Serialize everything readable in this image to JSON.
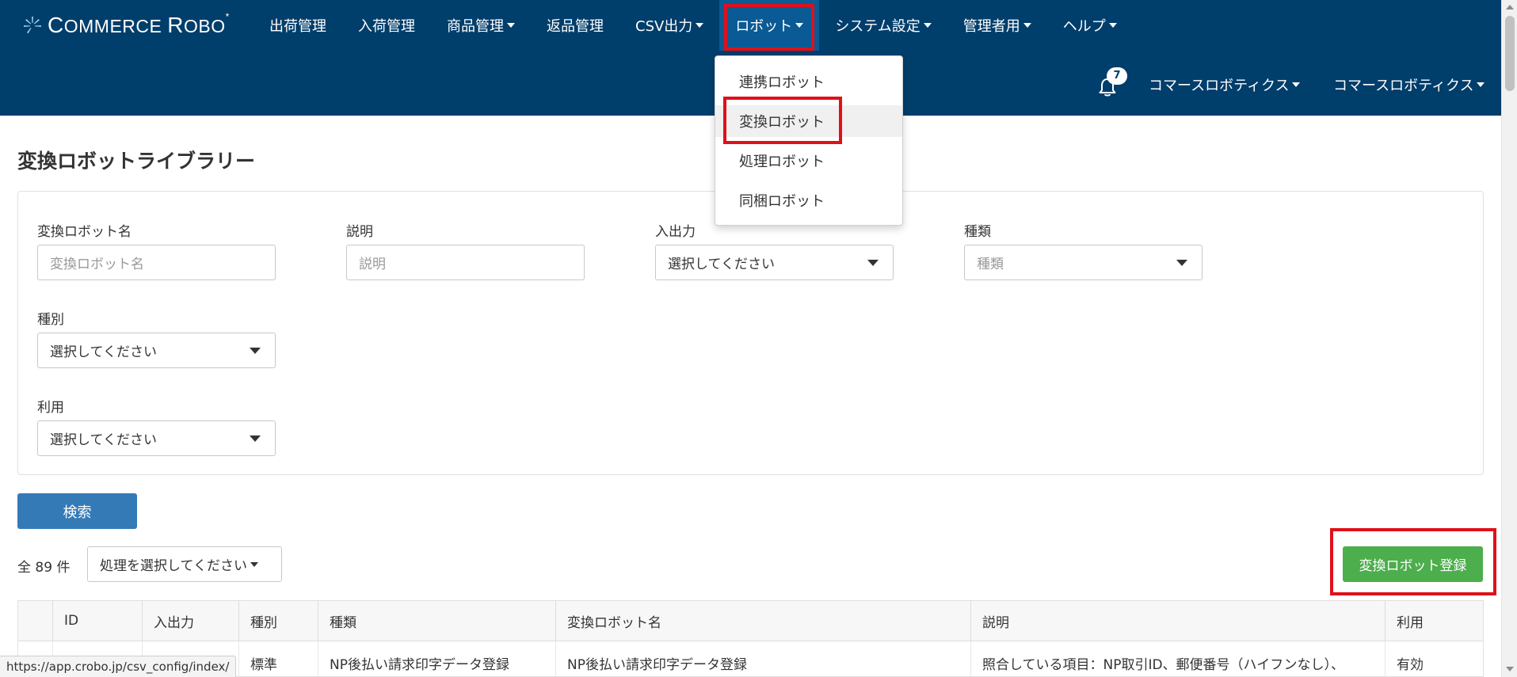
{
  "app": {
    "logo_text_c": "C",
    "logo_text_1": "OMMERCE ",
    "logo_text_r": "R",
    "logo_text_2": "OBO",
    "logo_mark": "*"
  },
  "nav": {
    "items": [
      {
        "label": "出荷管理"
      },
      {
        "label": "入荷管理"
      },
      {
        "label": "商品管理"
      },
      {
        "label": "返品管理"
      },
      {
        "label": "CSV出力"
      },
      {
        "label": "ロボット"
      },
      {
        "label": "システム設定"
      },
      {
        "label": "管理者用"
      },
      {
        "label": "ヘルプ"
      }
    ],
    "notification_count": "7",
    "user_company": "コマースロボティクス",
    "user_name": "コマースロボティクス"
  },
  "robot_menu": {
    "items": [
      {
        "label": "連携ロボット"
      },
      {
        "label": "変換ロボット"
      },
      {
        "label": "処理ロボット"
      },
      {
        "label": "同梱ロボット"
      }
    ]
  },
  "page": {
    "title": "変換ロボットライブラリー"
  },
  "filters": {
    "name_label": "変換ロボット名",
    "name_placeholder": "変換ロボット名",
    "desc_label": "説明",
    "desc_placeholder": "説明",
    "io_label": "入出力",
    "io_value": "選択してください",
    "kind_label": "種類",
    "kind_placeholder": "種類",
    "category_label": "種別",
    "category_value": "選択してください",
    "usage_label": "利用",
    "usage_value": "選択してください",
    "search_button": "検索"
  },
  "results": {
    "count": "全 89 件",
    "bulk_action": "処理を選択してください",
    "add_button": "変換ロボット登録"
  },
  "table": {
    "headers": [
      "ID",
      "入出力",
      "種別",
      "種類",
      "変換ロボット名",
      "説明",
      "利用"
    ],
    "rows": [
      {
        "id": "",
        "io": "",
        "category": "標準",
        "kind": "NP後払い請求印字データ登録",
        "name": "NP後払い請求印字データ登録",
        "description": "照合している項目：NP取引ID、郵便番号（ハイフンなし）、",
        "usage": "有効"
      }
    ]
  },
  "status_url": "https://app.crobo.jp/csv_config/index/",
  "colors": {
    "header_bg": "#003e6b",
    "active_nav_bg": "#0a5a95",
    "highlight_red": "#e0101a",
    "primary_button": "#337ab7",
    "success_button": "#4cae4c"
  }
}
